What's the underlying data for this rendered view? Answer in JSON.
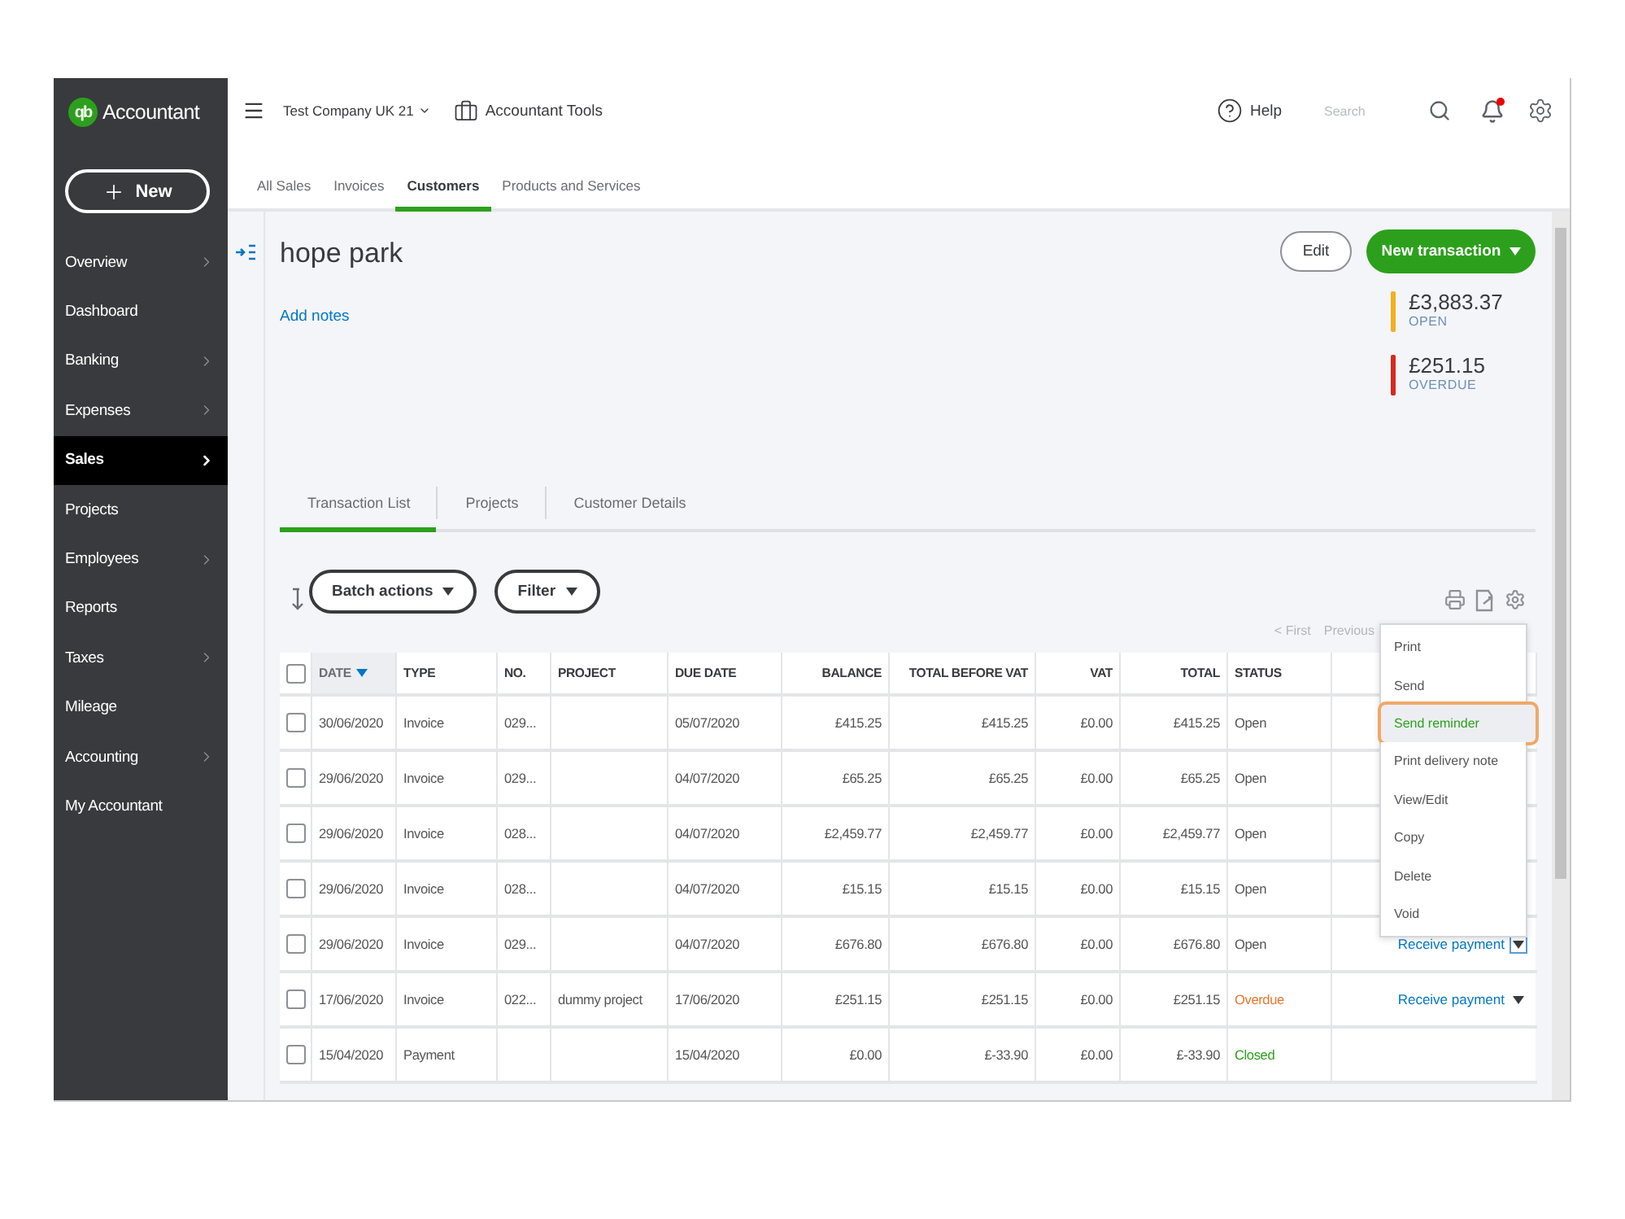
{
  "sidebar": {
    "logo": {
      "mark": "qb",
      "text": "Accountant"
    },
    "new_button": "New",
    "items": [
      {
        "label": "Overview",
        "has_submenu": true,
        "selected": false
      },
      {
        "label": "Dashboard",
        "has_submenu": false,
        "selected": false
      },
      {
        "label": "Banking",
        "has_submenu": true,
        "selected": false
      },
      {
        "label": "Expenses",
        "has_submenu": true,
        "selected": false
      },
      {
        "label": "Sales",
        "has_submenu": true,
        "selected": true
      },
      {
        "label": "Projects",
        "has_submenu": false,
        "selected": false
      },
      {
        "label": "Employees",
        "has_submenu": true,
        "selected": false
      },
      {
        "label": "Reports",
        "has_submenu": false,
        "selected": false
      },
      {
        "label": "Taxes",
        "has_submenu": true,
        "selected": false
      },
      {
        "label": "Mileage",
        "has_submenu": false,
        "selected": false
      },
      {
        "label": "Accounting",
        "has_submenu": true,
        "selected": false
      },
      {
        "label": "My Accountant",
        "has_submenu": false,
        "selected": false
      }
    ]
  },
  "top_bar": {
    "company": "Test Company UK 21",
    "tools": "Accountant Tools",
    "help": "Help",
    "search": {
      "placeholder": "Search"
    },
    "has_notification": true
  },
  "tabs": [
    {
      "label": "All Sales",
      "selected": false
    },
    {
      "label": "Invoices",
      "selected": false
    },
    {
      "label": "Customers",
      "selected": true
    },
    {
      "label": "Products and Services",
      "selected": false
    }
  ],
  "customer": {
    "name": "hope park",
    "add_notes": "Add notes",
    "edit": "Edit",
    "new_transaction": "New transaction",
    "balances": [
      {
        "amount": "£3,883.37",
        "label": "OPEN",
        "color": "#f2b01e"
      },
      {
        "amount": "£251.15",
        "label": "OVERDUE",
        "color": "#d52b1e"
      }
    ]
  },
  "subtabs": [
    {
      "label": "Transaction List",
      "selected": true
    },
    {
      "label": "Projects",
      "selected": false
    },
    {
      "label": "Customer Details",
      "selected": false
    }
  ],
  "toolbar": {
    "batch_actions": "Batch actions",
    "filter": "Filter"
  },
  "pagination": [
    "< First",
    "Previous"
  ],
  "table": {
    "select_all": {
      "checked": false
    },
    "columns": [
      {
        "label": "DATE",
        "sorted": true
      },
      {
        "label": "TYPE",
        "sorted": false
      },
      {
        "label": "NO.",
        "sorted": false
      },
      {
        "label": "PROJECT",
        "sorted": false
      },
      {
        "label": "DUE DATE",
        "sorted": false
      },
      {
        "label": "BALANCE",
        "sorted": false
      },
      {
        "label": "TOTAL BEFORE VAT",
        "sorted": false
      },
      {
        "label": "VAT",
        "sorted": false
      },
      {
        "label": "TOTAL",
        "sorted": false
      },
      {
        "label": "STATUS",
        "sorted": false
      }
    ],
    "rows": [
      {
        "checked": false,
        "cells": [
          "30/06/2020",
          "Invoice",
          "029...",
          null,
          "05/07/2020",
          "£415.25",
          "£415.25",
          "£0.00",
          "£415.25",
          "Open"
        ],
        "color": "#555555"
      },
      {
        "checked": false,
        "cells": [
          "29/06/2020",
          "Invoice",
          "029...",
          null,
          "04/07/2020",
          "£65.25",
          "£65.25",
          "£0.00",
          "£65.25",
          "Open"
        ],
        "color": "#555555"
      },
      {
        "checked": false,
        "cells": [
          "29/06/2020",
          "Invoice",
          "028...",
          null,
          "04/07/2020",
          "£2,459.77",
          "£2,459.77",
          "£0.00",
          "£2,459.77",
          "Open"
        ],
        "color": "#555555"
      },
      {
        "checked": false,
        "cells": [
          "29/06/2020",
          "Invoice",
          "028...",
          null,
          "04/07/2020",
          "£15.15",
          "£15.15",
          "£0.00",
          "£15.15",
          "Open"
        ],
        "color": "#555555"
      },
      {
        "checked": false,
        "cells": [
          "29/06/2020",
          "Invoice",
          "029...",
          null,
          "04/07/2020",
          "£676.80",
          "£676.80",
          "£0.00",
          "£676.80",
          "Open"
        ],
        "color": "#555555",
        "action": {
          "label": "Receive payment",
          "focused": true
        }
      },
      {
        "checked": false,
        "cells": [
          "17/06/2020",
          "Invoice",
          "022...",
          "dummy project",
          "17/06/2020",
          "£251.15",
          "£251.15",
          "£0.00",
          "£251.15",
          "Overdue"
        ],
        "color": "#e8772e",
        "action": {
          "label": "Receive payment",
          "focused": false
        }
      },
      {
        "checked": false,
        "cells": [
          "15/04/2020",
          "Payment",
          null,
          null,
          "15/04/2020",
          "£0.00",
          "£-33.90",
          "£0.00",
          "£-33.90",
          "Closed"
        ],
        "color": "#2ca01c"
      }
    ]
  },
  "action_menu": [
    {
      "label": "Print",
      "highlighted": false
    },
    {
      "label": "Send",
      "highlighted": false
    },
    {
      "label": "Send reminder",
      "highlighted": true
    },
    {
      "label": "Print delivery note",
      "highlighted": false
    },
    {
      "label": "View/Edit",
      "highlighted": false
    },
    {
      "label": "Copy",
      "highlighted": false
    },
    {
      "label": "Delete",
      "highlighted": false
    },
    {
      "label": "Void",
      "highlighted": false
    }
  ]
}
